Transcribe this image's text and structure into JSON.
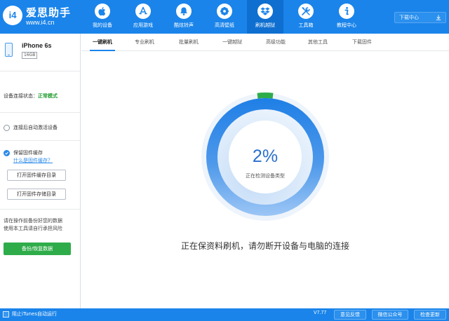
{
  "brand": {
    "badge": "i4",
    "name": "爱思助手",
    "url": "www.i4.cn"
  },
  "nav": [
    {
      "label": "我的设备",
      "icon": "apple-icon"
    },
    {
      "label": "应用游戏",
      "icon": "app-store-icon"
    },
    {
      "label": "酷炫铃声",
      "icon": "bell-icon"
    },
    {
      "label": "高清壁纸",
      "icon": "flower-icon"
    },
    {
      "label": "刷机越狱",
      "icon": "dropbox-icon",
      "active": true
    },
    {
      "label": "工具箱",
      "icon": "tools-icon"
    },
    {
      "label": "教程中心",
      "icon": "info-icon"
    }
  ],
  "header": {
    "download_center": "下载中心"
  },
  "device": {
    "name": "iPhone 6s",
    "capacity": "16GB"
  },
  "sidebar": {
    "status_label": "设备连接状态：",
    "status_value": "正常模式",
    "auto_activate": "连接后自动激活设备",
    "keep_cache": "保留固件缓存",
    "what_is_cache": "什么是固件缓存？",
    "open_cache_dir": "打开固件缓存目录",
    "open_store_dir": "打开固件存储目录",
    "warning_line1": "请在操作前备份好您的数据",
    "warning_line2": "使用本工具请自行承担风险",
    "backup_button": "备份/恢复数据"
  },
  "tabs": [
    {
      "label": "一键刷机",
      "active": true
    },
    {
      "label": "专业刷机"
    },
    {
      "label": "批量刷机"
    },
    {
      "label": "一键越狱"
    },
    {
      "label": "高级功能"
    },
    {
      "label": "其他工具"
    },
    {
      "label": "下载固件"
    }
  ],
  "progress": {
    "percent_text": "2%",
    "value": 0.02,
    "phase": "正在检测设备类型",
    "message": "正在保资料刷机，请勿断开设备与电脑的连接"
  },
  "footer": {
    "itunes_label": "阻止iTunes自动运行",
    "version": "V7.77",
    "feedback": "意见反馈",
    "wechat": "微信公众号",
    "update": "检查更新"
  },
  "colors": {
    "brand_blue": "#1a84ea",
    "ring_outer": "#4c95e6",
    "ring_inner": "#cfe3fb",
    "progress_green": "#2fac4a"
  }
}
